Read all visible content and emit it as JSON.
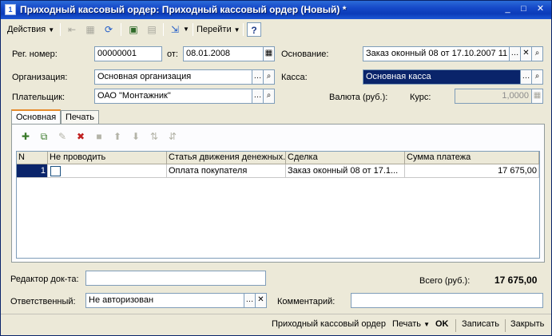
{
  "window": {
    "title": "Приходный кассовый ордер: Приходный кассовый ордер (Новый) *"
  },
  "toolbar": {
    "actions_label": "Действия",
    "goto_label": "Перейти",
    "help_label": "?"
  },
  "form": {
    "reg_number_label": "Рег. номер:",
    "reg_number_value": "00000001",
    "date_label": "от:",
    "date_value": "08.01.2008",
    "basis_label": "Основание:",
    "basis_value": "Заказ оконный 08 от 17.10.2007 11",
    "org_label": "Организация:",
    "org_value": "Основная организация",
    "cash_label": "Касса:",
    "cash_value": "Основная касса",
    "payer_label": "Плательщик:",
    "payer_value": "ОАО \"Монтажник\"",
    "currency_label": "Валюта (руб.):",
    "rate_label": "Курс:",
    "rate_value": "1,0000"
  },
  "tabs": [
    {
      "label": "Основная"
    },
    {
      "label": "Печать"
    }
  ],
  "table": {
    "columns": [
      "N",
      "Не проводить",
      "Статья движения денежных...",
      "Сделка",
      "Сумма платежа"
    ],
    "rows": [
      {
        "n": "1",
        "no_post": false,
        "article": "Оплата покупателя",
        "deal": "Заказ оконный 08 от 17.1...",
        "amount": "17 675,00"
      }
    ]
  },
  "footer": {
    "editor_label": "Редактор док-та:",
    "editor_value": "",
    "total_label": "Всего (руб.):",
    "total_value": "17 675,00",
    "responsible_label": "Ответственный:",
    "responsible_value": "Не авторизован",
    "comment_label": "Комментарий:",
    "comment_value": ""
  },
  "statusbar": {
    "doc_label": "Приходный кассовый ордер",
    "print_label": "Печать",
    "ok_label": "OK",
    "save_label": "Записать",
    "close_label": "Закрыть"
  },
  "colors": {
    "title_bar": "#1548c8",
    "selection": "#0a246a",
    "window_bg": "#ece9d8",
    "active_tab_accent": "#e68b2c"
  }
}
